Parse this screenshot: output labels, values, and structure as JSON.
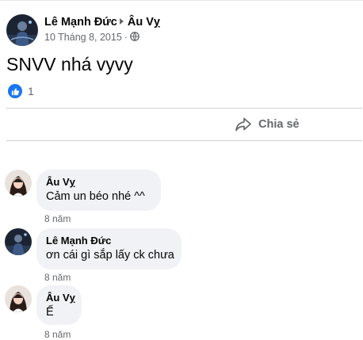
{
  "post": {
    "author": "Lê Mạnh Đức",
    "target": "Âu Vỵ",
    "date": "10 Tháng 8, 2015",
    "separator": "·",
    "privacy_icon": "globe-icon",
    "text": "SNVV nhá vyvy",
    "reaction_icon": "like-icon",
    "reaction_count": "1",
    "share_label": "Chia sẻ"
  },
  "comments": [
    {
      "author": "Âu Vỵ",
      "text": "Cảm un béo nhé ^^",
      "time": "8 năm"
    },
    {
      "author": "Lê Mạnh Đức",
      "text": "ơn cái gì sắp lấy ck chưa",
      "time": "8 năm"
    },
    {
      "author": "Âu Vỵ",
      "text": "Ế",
      "time": "8 năm"
    }
  ],
  "colors": {
    "like_blue": "#1877f2",
    "secondary_text": "#65676b",
    "bubble_bg": "#f0f2f5"
  }
}
